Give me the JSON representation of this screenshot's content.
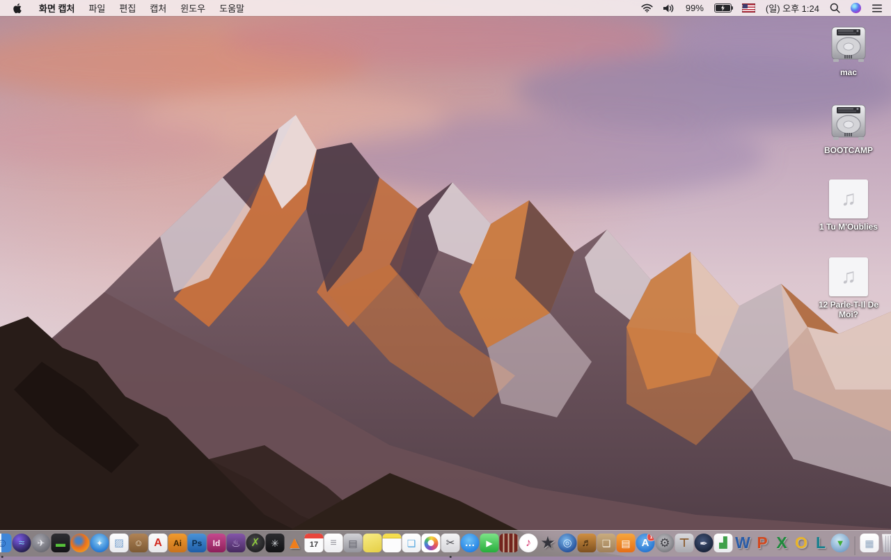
{
  "menu_bar": {
    "app_menus": [
      {
        "name": "app-name",
        "label": "화면 캡처",
        "bold": true
      },
      {
        "name": "file",
        "label": "파일"
      },
      {
        "name": "edit",
        "label": "편집"
      },
      {
        "name": "capture",
        "label": "캡처"
      },
      {
        "name": "window",
        "label": "윈도우"
      },
      {
        "name": "help",
        "label": "도움말"
      }
    ],
    "status": {
      "battery_percent": "99%",
      "clock": "(일) 오후 1:24"
    }
  },
  "desktop_icons": [
    {
      "name": "mac",
      "type": "drive",
      "label": "mac"
    },
    {
      "name": "bootcamp",
      "type": "drive",
      "label": "BOOTCAMP"
    },
    {
      "name": "audio-1",
      "type": "audio",
      "label": "1 Tu M'Oublies",
      "glyph": "♫"
    },
    {
      "name": "audio-2",
      "type": "audio",
      "label": "12 Parle-T-Il De Moi?",
      "glyph": "♫"
    }
  ],
  "dock": {
    "items": [
      {
        "name": "finder",
        "shape": "rounded",
        "bg": "linear-gradient(90deg,#eaf3fb 0 46%,#3f86d8 46%)",
        "glyph": "☺",
        "fg": "#1b4e9c",
        "fs": 17,
        "running": true
      },
      {
        "name": "siri",
        "shape": "circle",
        "bg": "radial-gradient(circle at 35% 30%,#7d5ce6,#241f4e 75%)",
        "glyph": "≈",
        "fg": "#7fd8ef",
        "fs": 15
      },
      {
        "name": "launchpad",
        "shape": "circle",
        "bg": "radial-gradient(circle at 40% 35%,#a8a8b0,#55555e)",
        "glyph": "✈",
        "fg": "#ececf2",
        "fs": 13
      },
      {
        "name": "eyetv",
        "shape": "rounded",
        "bg": "linear-gradient(#2e2e33,#141416)",
        "glyph": "▬",
        "fg": "#56c23a",
        "fs": 14
      },
      {
        "name": "firefox",
        "shape": "circle",
        "bg": "radial-gradient(circle at 42% 38%,#4a7fc0 0 18%,#e8701e 45%,#f6a21f 85%)",
        "glyph": "",
        "fg": "#ffffff",
        "fs": 12
      },
      {
        "name": "safari",
        "shape": "circle",
        "bg": "radial-gradient(circle at 50% 38%,#8ed0f5,#1d71cf 80%)",
        "glyph": "✦",
        "fg": "#f2f5f8",
        "fs": 12
      },
      {
        "name": "preview",
        "shape": "rounded",
        "bg": "linear-gradient(#fdfdfe,#e9eaee)",
        "glyph": "▨",
        "fg": "#7ba3cf",
        "fs": 15
      },
      {
        "name": "contacts",
        "shape": "rounded",
        "bg": "linear-gradient(#b08355,#7d5a34)",
        "glyph": "☺",
        "fg": "#efe3cd",
        "fs": 13
      },
      {
        "name": "acrobat-reader",
        "shape": "rounded",
        "bg": "linear-gradient(#fbfbfb,#e8e8ea)",
        "glyph": "A",
        "fg": "#d2281e",
        "fs": 16,
        "fw": 700
      },
      {
        "name": "illustrator",
        "shape": "rounded",
        "bg": "linear-gradient(#f09a2e,#c9731c)",
        "glyph": "Ai",
        "fg": "#3a2300",
        "fs": 12,
        "fw": 700
      },
      {
        "name": "photoshop",
        "shape": "rounded",
        "bg": "linear-gradient(#4a93d8,#1f5ea8)",
        "glyph": "Ps",
        "fg": "#0a2a4a",
        "fs": 12,
        "fw": 700
      },
      {
        "name": "indesign",
        "shape": "rounded",
        "bg": "linear-gradient(#c5498e,#8e1f5a)",
        "glyph": "Id",
        "fg": "#fbe8f3",
        "fs": 12,
        "fw": 700
      },
      {
        "name": "toast",
        "shape": "rounded",
        "bg": "linear-gradient(#8456aa,#46295f)",
        "glyph": "♨",
        "fg": "#d8c2ec",
        "fs": 14
      },
      {
        "name": "green-x-disc-app",
        "shape": "circle",
        "bg": "radial-gradient(circle at 45% 40%,#4a4a4c,#101012)",
        "glyph": "✗",
        "fg": "#8cc63f",
        "fs": 16,
        "fw": 700
      },
      {
        "name": "fan-drive-utility",
        "shape": "rounded",
        "bg": "linear-gradient(#2c2c30,#121214)",
        "glyph": "✳",
        "fg": "#d3d6da",
        "fs": 14
      },
      {
        "name": "vlc",
        "shape": "none",
        "bg": "none",
        "glyph": "▲",
        "fg": "#ef7e1b",
        "fs": 24
      },
      {
        "name": "calendar",
        "shape": "rounded",
        "bg": "#fbfbfc",
        "cls": "cal",
        "glyph": "17",
        "fg": "#3a3a3c",
        "fs": 11,
        "fw": 700
      },
      {
        "name": "reminders",
        "shape": "rounded",
        "bg": "linear-gradient(#ffffff,#ededf0)",
        "glyph": "≡",
        "fg": "#9a9aa2",
        "fs": 16
      },
      {
        "name": "archive-box-app",
        "shape": "rounded",
        "bg": "linear-gradient(#d2d2d6,#94949c)",
        "glyph": "▤",
        "fg": "#5c5c66",
        "fs": 14
      },
      {
        "name": "stickies",
        "shape": "rounded",
        "bg": "linear-gradient(160deg,#f8ec86,#e5cf45)",
        "glyph": "",
        "fg": "#000000",
        "fs": 12
      },
      {
        "name": "notes",
        "shape": "rounded",
        "bg": "#fcfcfd",
        "cls": "notes",
        "glyph": "",
        "fg": "#000000",
        "fs": 12
      },
      {
        "name": "cards-app",
        "shape": "rounded",
        "bg": "linear-gradient(#ffffff,#eef0f2)",
        "glyph": "❏",
        "fg": "#53a7e0",
        "fs": 14,
        "fw": 700
      },
      {
        "name": "photos",
        "shape": "rounded",
        "bg": "#ffffff",
        "cls": "photos",
        "glyph": "",
        "fg": "#000000",
        "fs": 12
      },
      {
        "name": "grab",
        "shape": "rounded",
        "bg": "linear-gradient(#f4f4f6,#d6d6da)",
        "glyph": "✂",
        "fg": "#4a4a50",
        "fs": 15,
        "running": true
      },
      {
        "name": "messages",
        "shape": "circle",
        "bg": "radial-gradient(circle at 45% 35%,#6cc0f7,#1e7ce2 80%)",
        "glyph": "…",
        "fg": "#ffffff",
        "fs": 15,
        "fw": 700
      },
      {
        "name": "facetime",
        "shape": "rounded",
        "bg": "linear-gradient(#7ce487,#27ad3c)",
        "glyph": "▶",
        "fg": "#ffffff",
        "fs": 12
      },
      {
        "name": "photo-booth",
        "shape": "rounded",
        "bg": "repeating-linear-gradient(90deg,#73241d 0 5px,#c8b29a 5px 7px)",
        "glyph": "",
        "fg": "#000000",
        "fs": 12
      },
      {
        "name": "itunes",
        "shape": "circle",
        "bg": "radial-gradient(circle at 50% 45%,#ffffff 55%,#e8e8ee)",
        "glyph": "♪",
        "fg": "#d6336c",
        "fs": 16,
        "fw": 700
      },
      {
        "name": "imovie",
        "shape": "none",
        "bg": "none",
        "glyph": "★",
        "fg": "#34343c",
        "fs": 24
      },
      {
        "name": "idvd",
        "shape": "circle",
        "bg": "radial-gradient(circle at 42% 36%,#7cb8ec,#17418f 85%)",
        "glyph": "◎",
        "fg": "#d9ecff",
        "fs": 15
      },
      {
        "name": "garageband",
        "shape": "rounded",
        "bg": "linear-gradient(#cf8f41,#7e5120)",
        "glyph": "♬",
        "fg": "#31200a",
        "fs": 15
      },
      {
        "name": "collage-kit-app",
        "shape": "rounded",
        "bg": "linear-gradient(#c9ac7e,#a0805a)",
        "glyph": "❏",
        "fg": "#f6efe0",
        "fs": 14,
        "fw": 700
      },
      {
        "name": "ibooks",
        "shape": "rounded",
        "bg": "linear-gradient(#f7a63c,#e56f17)",
        "glyph": "▤",
        "fg": "#ffffff",
        "fs": 14
      },
      {
        "name": "app-store",
        "shape": "circle",
        "bg": "radial-gradient(circle at 45% 38%,#6fb4f0,#1b6ccc 85%)",
        "glyph": "A",
        "fg": "#ffffff",
        "fs": 15,
        "fw": 700,
        "badge": "1"
      },
      {
        "name": "system-preferences",
        "shape": "circle",
        "bg": "radial-gradient(circle at 45% 40%,#c6c6ca,#626268)",
        "glyph": "⚙",
        "fg": "#3e3e44",
        "fs": 17
      },
      {
        "name": "keynote-old",
        "shape": "rounded",
        "bg": "linear-gradient(#d9d9dd,#aaaab0)",
        "glyph": "⊤",
        "fg": "#8a5a2c",
        "fs": 17,
        "fw": 700
      },
      {
        "name": "pages-old",
        "shape": "circle",
        "bg": "radial-gradient(circle at 45% 38%,#44557a,#121c30 85%)",
        "glyph": "✒",
        "fg": "#e8e8f0",
        "fs": 14
      },
      {
        "name": "numbers-old",
        "shape": "rounded",
        "bg": "linear-gradient(#ffffff,#e9ebee)",
        "glyph": "▟",
        "fg": "#3fa04a",
        "fs": 15
      },
      {
        "name": "word",
        "shape": "none",
        "bg": "none",
        "glyph": "W",
        "fg": "#2a5ca8",
        "fs": 23,
        "fw": 800
      },
      {
        "name": "powerpoint",
        "shape": "none",
        "bg": "none",
        "glyph": "P",
        "fg": "#d2491f",
        "fs": 23,
        "fw": 800
      },
      {
        "name": "excel",
        "shape": "none",
        "bg": "none",
        "glyph": "X",
        "fg": "#1e8a3c",
        "fs": 23,
        "fw": 800
      },
      {
        "name": "outlook",
        "shape": "none",
        "bg": "none",
        "glyph": "O",
        "fg": "#e8b42a",
        "fs": 23,
        "fw": 800
      },
      {
        "name": "lync",
        "shape": "none",
        "bg": "none",
        "glyph": "L",
        "fg": "#17808e",
        "fs": 23,
        "fw": 800
      },
      {
        "name": "download-manager",
        "shape": "circle",
        "bg": "radial-gradient(circle at 42% 35%,#cfe7f4,#6a96c2 85%)",
        "glyph": "▼",
        "fg": "#3fae35",
        "fs": 13,
        "fw": 700
      },
      {
        "type": "divider",
        "name": "dock-divider"
      },
      {
        "name": "downloads-doc",
        "shape": "rounded",
        "bg": "linear-gradient(#ffffff,#f0f1f4)",
        "glyph": "▦",
        "fg": "#8fa6c0",
        "fs": 14
      },
      {
        "name": "trash-full",
        "shape": "none",
        "bg": "none",
        "cls": "trash",
        "glyph": "",
        "fg": "#000000",
        "fs": 12
      }
    ]
  }
}
